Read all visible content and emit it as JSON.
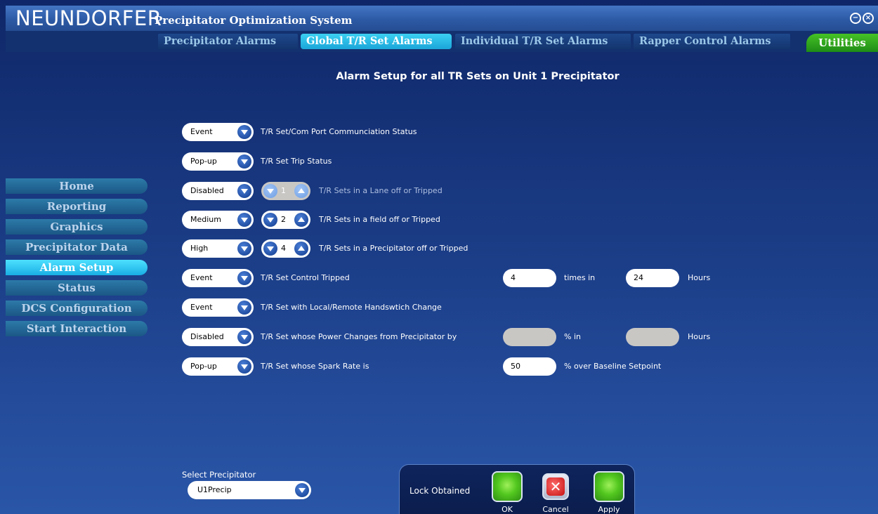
{
  "header": {
    "brand": "NEUNDORFER",
    "app_title": "Precipitator Optimization System"
  },
  "tabs": [
    {
      "label": "Precipitator Alarms",
      "active": false
    },
    {
      "label": "Global T/R Set Alarms",
      "active": true
    },
    {
      "label": "Individual T/R Set Alarms",
      "active": false
    },
    {
      "label": "Rapper Control Alarms",
      "active": false
    }
  ],
  "utilities_label": "Utilities",
  "page_heading": "Alarm Setup for all TR Sets on Unit 1 Precipitator",
  "nav": [
    {
      "label": "Home"
    },
    {
      "label": "Reporting"
    },
    {
      "label": "Graphics"
    },
    {
      "label": "Precipitator Data"
    },
    {
      "label": "Alarm Setup",
      "active": true
    },
    {
      "label": "Status"
    },
    {
      "label": "DCS Configuration"
    },
    {
      "label": "Start Interaction"
    }
  ],
  "alarms": [
    {
      "level": "Event",
      "label": "T/R Set/Com Port Communciation Status"
    },
    {
      "level": "Pop-up",
      "label": "T/R Set Trip Status"
    },
    {
      "level": "Disabled",
      "count": "1",
      "label": "T/R Sets in a Lane off or Tripped"
    },
    {
      "level": "Medium",
      "count": "2",
      "label": "T/R Sets in a field off or Tripped"
    },
    {
      "level": "High",
      "count": "4",
      "label": "T/R Sets in a Precipitator off or Tripped"
    },
    {
      "level": "Event",
      "label": "T/R Set Control Tripped",
      "value1": "4",
      "unit1": "times in",
      "value2": "24",
      "unit2": "Hours"
    },
    {
      "level": "Event",
      "label": "T/R Set with Local/Remote Handswtich Change"
    },
    {
      "level": "Disabled",
      "label": "T/R Set whose Power Changes from Precipitator by",
      "value1": "",
      "unit1": "% in",
      "value2": "",
      "unit2": "Hours"
    },
    {
      "level": "Pop-up",
      "label": "T/R Set whose Spark Rate is",
      "value1": "50",
      "unit1": "% over Baseline Setpoint"
    }
  ],
  "precipitator": {
    "label": "Select Precipitator",
    "value": "U1Precip"
  },
  "lock_panel": {
    "status": "Lock Obtained",
    "ok_label": "OK",
    "cancel_label": "Cancel",
    "apply_label": "Apply"
  }
}
